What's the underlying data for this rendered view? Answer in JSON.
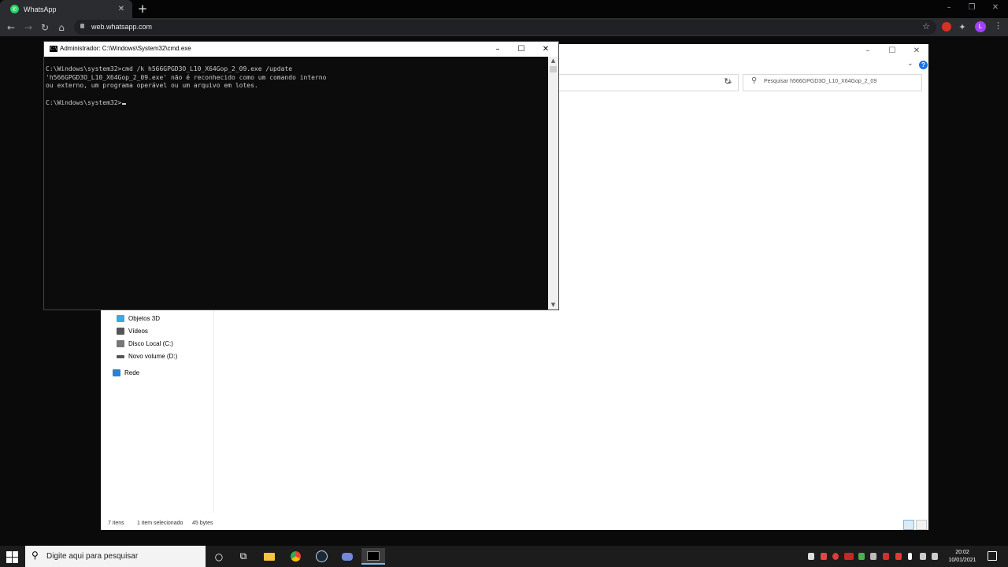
{
  "browser": {
    "tab_title": "WhatsApp",
    "tab_close": "✕",
    "new_tab": "+",
    "url": "web.whatsapp.com",
    "profile_initial": "L",
    "window_controls": {
      "minimize": "–",
      "restore": "❐",
      "close": "✕"
    }
  },
  "explorer": {
    "search_placeholder": "Pesquisar h566GPGD3O_L10_X64Gop_2_09",
    "nav_items": [
      {
        "label": "Objetos 3D",
        "icon": "3d-objects-icon",
        "color": "#3ea8e0"
      },
      {
        "label": "Vídeos",
        "icon": "videos-icon",
        "color": "#555555"
      },
      {
        "label": "Disco Local (C:)",
        "icon": "local-disk-icon",
        "color": "#777777"
      },
      {
        "label": "Novo volume (D:)",
        "icon": "drive-icon",
        "color": "#555555"
      },
      {
        "label": "Rede",
        "icon": "network-icon",
        "color": "#2f7fd0"
      }
    ],
    "status": {
      "items_count": "7 itens",
      "selection": "1 item selecionado",
      "size": "45 bytes"
    }
  },
  "cmd": {
    "title": "Administrador: C:\\Windows\\System32\\cmd.exe",
    "lines": [
      "C:\\Windows\\system32>cmd /k h566GPGD3O_L10_X64Gop_2_09.exe /update",
      "'h566GPGD3O_L10_X64Gop_2_09.exe' não é reconhecido como um comando interno",
      "ou externo, um programa operável ou um arquivo em lotes.",
      "",
      "C:\\Windows\\system32>"
    ]
  },
  "taskbar": {
    "search_placeholder": "Digite aqui para pesquisar",
    "pinned": [
      "cortana-icon",
      "task-view-icon",
      "file-explorer-icon",
      "chrome-icon",
      "steam-icon",
      "discord-icon",
      "terminal-icon"
    ],
    "time": "20:02",
    "date": "10/01/2021"
  },
  "colors": {
    "cmd_background": "#0c0c0c",
    "cmd_text": "#cccccc",
    "whatsapp_green": "#25d366",
    "taskbar": "#1c1c1c"
  }
}
